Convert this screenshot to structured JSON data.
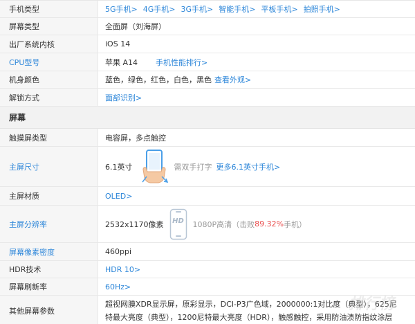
{
  "rows_top": [
    {
      "label": "手机类型",
      "label_blue": false,
      "links": [
        "5G手机>",
        "4G手机>",
        "3G手机>",
        "智能手机>",
        "平板手机>",
        "拍照手机>"
      ]
    },
    {
      "label": "屏幕类型",
      "label_blue": false,
      "text": "全面屏（刘海屏）"
    },
    {
      "label": "出厂系统内核",
      "label_blue": false,
      "text": "iOS 14"
    },
    {
      "label": "CPU型号",
      "label_blue": true,
      "text": "苹果 A14",
      "link": "手机性能排行>"
    },
    {
      "label": "机身颜色",
      "label_blue": false,
      "text": "蓝色，绿色，红色，白色，黑色",
      "link": "查看外观>"
    },
    {
      "label": "解锁方式",
      "label_blue": false,
      "link_only": "面部识别>"
    }
  ],
  "section_title": "屏幕",
  "screen": {
    "touch": {
      "label": "触摸屏类型",
      "text": "电容屏，多点触控"
    },
    "size": {
      "label": "主屏尺寸",
      "value": "6.1英寸",
      "hint": "需双手打字",
      "link": "更多6.1英寸手机>",
      "icon": "hand-phone-icon"
    },
    "material": {
      "label": "主屏材质",
      "link": "OLED>"
    },
    "resolution": {
      "label": "主屏分辨率",
      "value": "2532x1170像素",
      "hd": "HD",
      "desc_prefix": "1080P高清（击败",
      "percent": "89.32%",
      "desc_suffix": "手机）",
      "icon": "hd-phone-icon"
    },
    "density": {
      "label": "屏幕像素密度",
      "text": "460ppi"
    },
    "hdr": {
      "label": "HDR技术",
      "link": "HDR 10>"
    },
    "refresh": {
      "label": "屏幕刷新率",
      "link": "60Hz>"
    },
    "other": {
      "label": "其他屏幕参数",
      "text": "超视网膜XDR显示屏，原彩显示，DCI-P3广色域，2000000:1对比度（典型），625尼特最大亮度（典型），1200尼特最大亮度（HDR），触感触控，采用防油渍防指纹涂层"
    }
  },
  "watermark": "排行榜",
  "colors": {
    "link": "#2c86d9",
    "highlight": "#e94e4e",
    "label_bg": "#f6f6f6",
    "section_bg": "#f2f2f2"
  }
}
